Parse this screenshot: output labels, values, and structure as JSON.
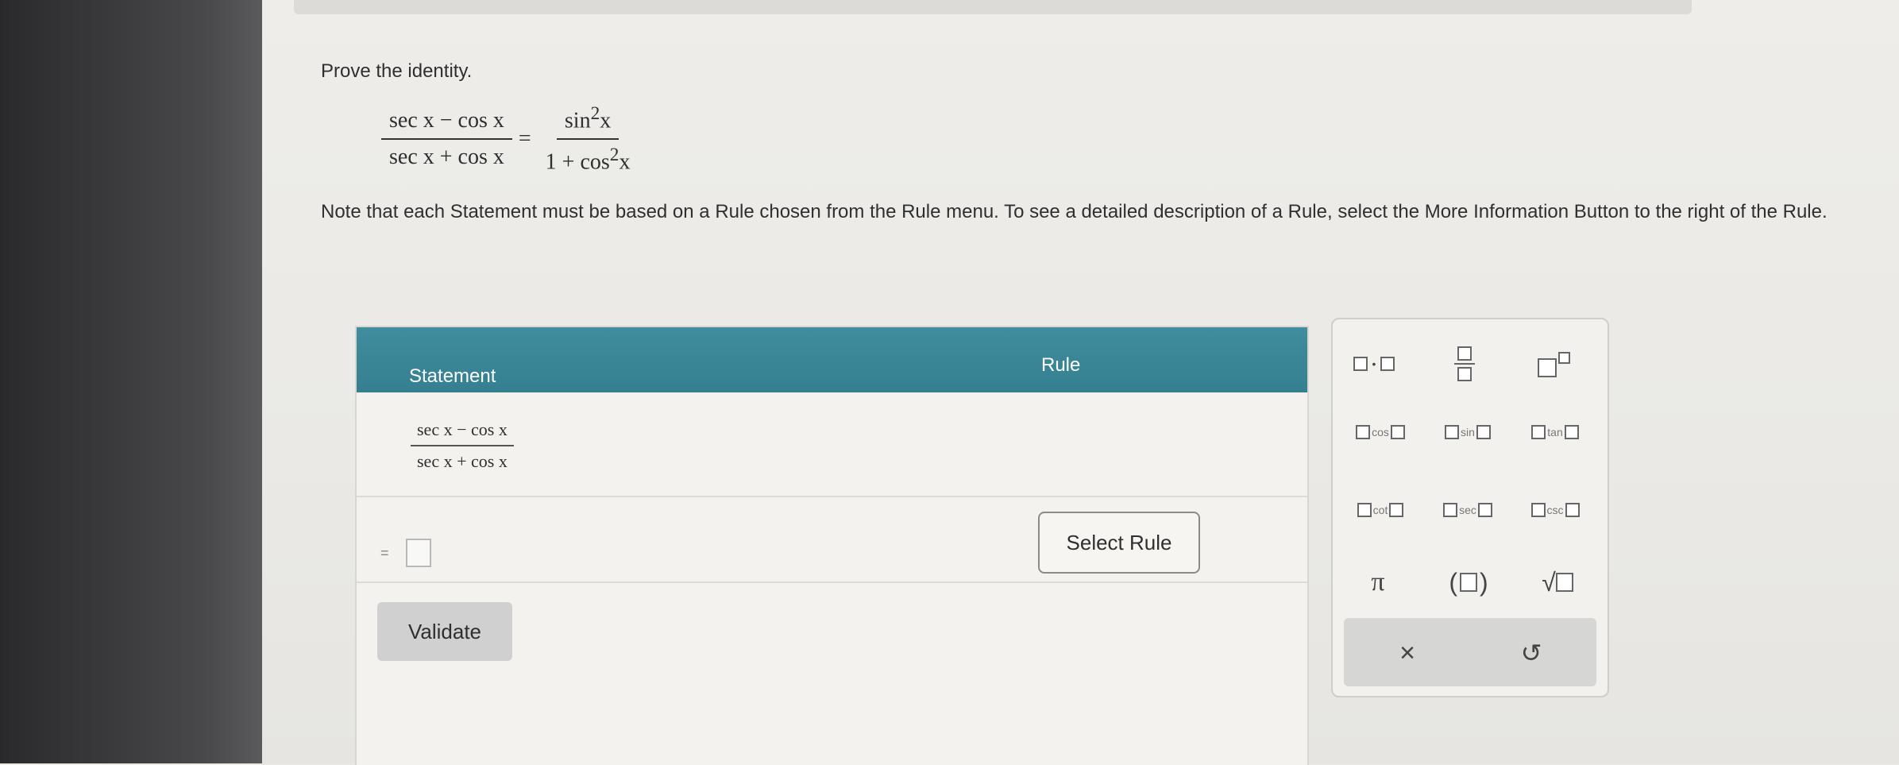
{
  "problem": {
    "prompt": "Prove the identity.",
    "lhs_num": "sec x − cos x",
    "lhs_den": "sec x + cos x",
    "equals": "=",
    "rhs_num_base": "sin",
    "rhs_num_exp": "2",
    "rhs_num_var": "x",
    "rhs_den_pre": "1 + cos",
    "rhs_den_exp": "2",
    "rhs_den_var": "x",
    "note": "Note that each Statement must be based on a Rule chosen from the Rule menu. To see a detailed description of a Rule, select the More Information Button to the right of the Rule."
  },
  "table": {
    "header_statement": "Statement",
    "header_rule": "Rule",
    "row1_num": "sec x − cos x",
    "row1_den": "sec x + cos x",
    "row2_eq": "=",
    "select_rule_label": "Select Rule",
    "validate_label": "Validate"
  },
  "palette": {
    "cos": "cos",
    "sin": "sin",
    "tan": "tan",
    "cot": "cot",
    "sec": "sec",
    "csc": "csc",
    "pi": "π",
    "close": "×",
    "undo": "↺",
    "multiply_dot": "•",
    "sqrt_symbol": "√",
    "paren_open": "(",
    "paren_close": ")"
  },
  "colors": {
    "header_bg": "#3f8d9e",
    "validate_bg": "#cfd0cf"
  }
}
